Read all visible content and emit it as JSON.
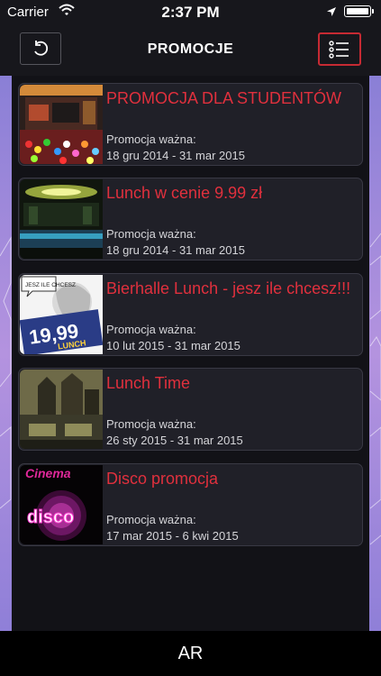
{
  "status_bar": {
    "carrier": "Carrier",
    "time": "2:37 PM"
  },
  "nav": {
    "title": "PROMOCJE"
  },
  "promotions": [
    {
      "name": "PROMOCJA DLA STUDENTÓW",
      "valid_label": "Promocja ważna:",
      "dates": "18 gru 2014 - 31 mar 2015"
    },
    {
      "name": "Lunch w cenie 9.99 zł",
      "valid_label": "Promocja ważna:",
      "dates": "18 gru 2014 - 31 mar 2015"
    },
    {
      "name": "Bierhalle Lunch - jesz ile chcesz!!!",
      "valid_label": "Promocja ważna:",
      "dates": "10 lut 2015 - 31 mar 2015"
    },
    {
      "name": "Lunch Time",
      "valid_label": "Promocja ważna:",
      "dates": "26 sty 2015 - 31 mar 2015"
    },
    {
      "name": "Disco promocja",
      "valid_label": "Promocja ważna:",
      "dates": "17 mar 2015 - 6 kwi 2015"
    }
  ],
  "thumb_text": {
    "p3_bubble": "JESZ ILE CHCESZ",
    "p3_price": "19,99",
    "p3_lunch": "LUNCH",
    "p5_top": "Cinema",
    "p5_word": "disco"
  },
  "bottom": {
    "label": "AR"
  },
  "colors": {
    "accent_red": "#e0303d",
    "menu_border": "#c62a33",
    "card_bg": "#202028",
    "side_gradient": "#b493df"
  }
}
